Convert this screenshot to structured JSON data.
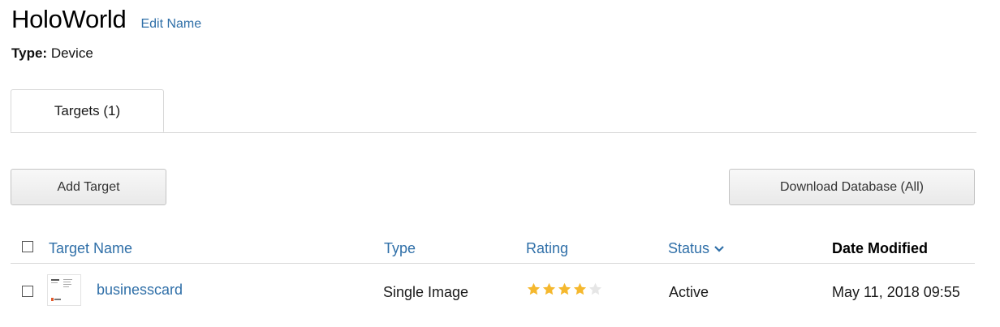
{
  "header": {
    "title": "HoloWorld",
    "edit_label": "Edit Name",
    "type_label": "Type:",
    "type_value": "Device"
  },
  "tabs": [
    {
      "label": "Targets (1)",
      "active": true
    }
  ],
  "toolbar": {
    "add_label": "Add Target",
    "download_label": "Download Database (All)"
  },
  "table": {
    "columns": {
      "name": "Target Name",
      "type": "Type",
      "rating": "Rating",
      "status": "Status",
      "date": "Date Modified"
    },
    "rows": [
      {
        "name": "businesscard",
        "type": "Single Image",
        "rating": 4,
        "rating_max": 5,
        "status": "Active",
        "date": "May 11, 2018 09:55"
      }
    ]
  },
  "colors": {
    "link": "#2f6fa8",
    "star_on": "#f5b82e",
    "star_off": "#e6e6e6"
  }
}
